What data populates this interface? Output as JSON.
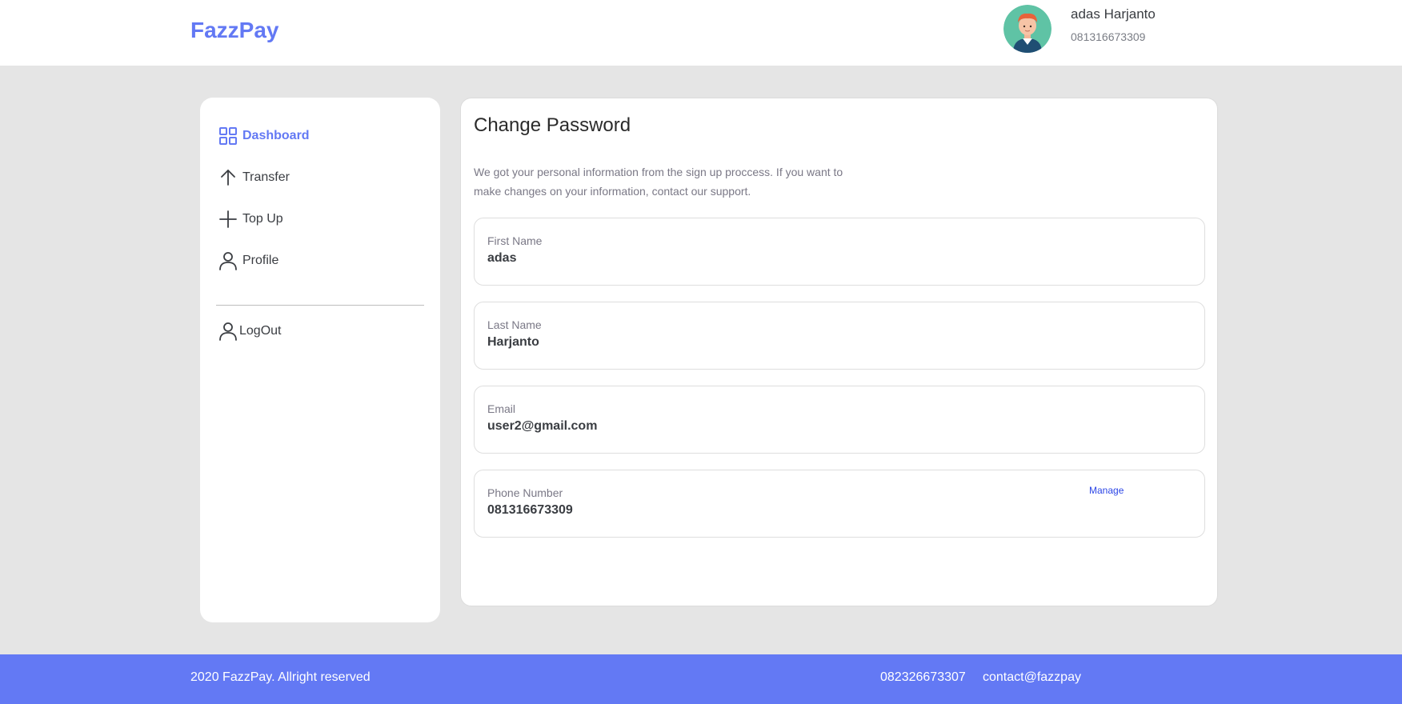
{
  "header": {
    "logo": "FazzPay",
    "user": {
      "name": "adas Harjanto",
      "phone": "081316673309"
    }
  },
  "sidebar": {
    "items": [
      {
        "label": "Dashboard",
        "icon": "grid-icon",
        "active": true
      },
      {
        "label": "Transfer",
        "icon": "arrow-up-icon"
      },
      {
        "label": "Top Up",
        "icon": "plus-icon"
      },
      {
        "label": "Profile",
        "icon": "user-icon"
      }
    ],
    "logout": {
      "label": "LogOut",
      "icon": "user-icon"
    }
  },
  "main": {
    "title": "Change Password",
    "description": "We got your personal information from the sign up proccess. If you want to make changes on your information, contact our support.",
    "fields": [
      {
        "label": "First Name",
        "value": "adas"
      },
      {
        "label": "Last Name",
        "value": "Harjanto"
      },
      {
        "label": "Email",
        "value": "user2@gmail.com"
      },
      {
        "label": "Phone Number",
        "value": "081316673309",
        "action": "Manage"
      }
    ]
  },
  "footer": {
    "copyright": "2020 FazzPay. Allright reserved",
    "phone": "082326673307",
    "email": "contact@fazzpay"
  },
  "colors": {
    "accent": "#6379f4",
    "link": "#2b45e6",
    "background": "#e5e5e5"
  }
}
